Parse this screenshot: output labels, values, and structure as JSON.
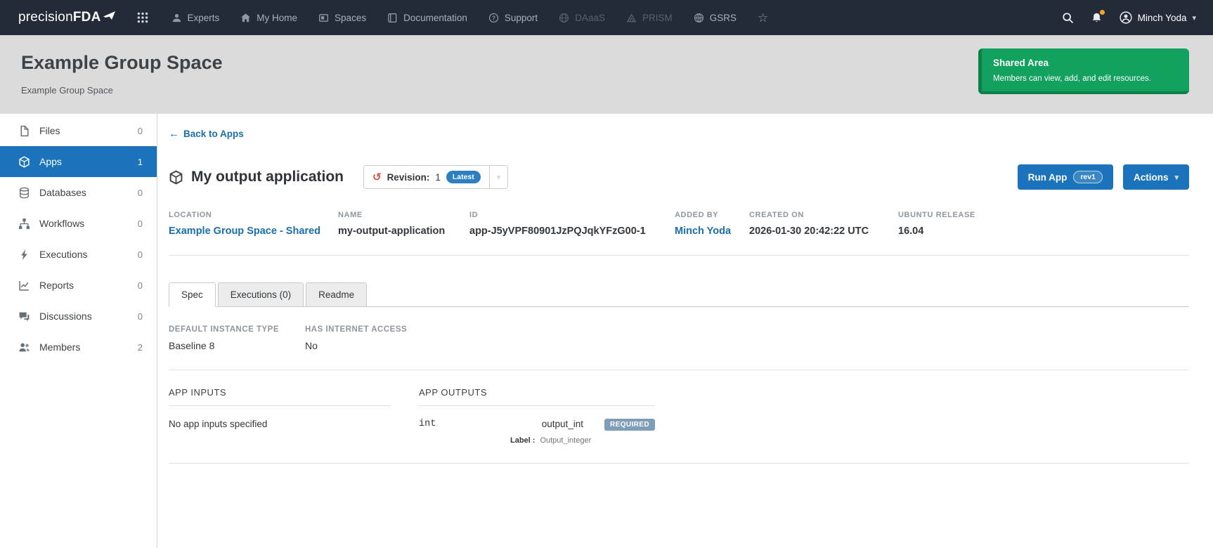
{
  "colors": {
    "navbar_bg": "#232b39",
    "accent_blue": "#1b74bb",
    "link_blue": "#1a6fad",
    "latest_badge_blue": "#2e7fc2",
    "shared_area_green": "#12a15f",
    "required_badge_blue": "#7f9db9",
    "notification_dot_orange": "#f5a623"
  },
  "navbar": {
    "brand_light": "precision",
    "brand_bold": "FDA",
    "items": [
      {
        "label": "Experts"
      },
      {
        "label": "My Home"
      },
      {
        "label": "Spaces"
      },
      {
        "label": "Documentation"
      },
      {
        "label": "Support"
      },
      {
        "label": "DAaaS"
      },
      {
        "label": "PRISM"
      },
      {
        "label": "GSRS"
      }
    ],
    "user_name": "Minch Yoda"
  },
  "header": {
    "title": "Example Group Space",
    "subtitle": "Example Group Space",
    "shared_area_title": "Shared Area",
    "shared_area_description": "Members can view, add, and edit resources."
  },
  "sidebar": {
    "items": [
      {
        "label": "Files",
        "count": "0"
      },
      {
        "label": "Apps",
        "count": "1"
      },
      {
        "label": "Databases",
        "count": "0"
      },
      {
        "label": "Workflows",
        "count": "0"
      },
      {
        "label": "Executions",
        "count": "0"
      },
      {
        "label": "Reports",
        "count": "0"
      },
      {
        "label": "Discussions",
        "count": "0"
      },
      {
        "label": "Members",
        "count": "2"
      }
    ]
  },
  "main": {
    "back_link": "Back to Apps",
    "app_title": "My output application",
    "revision_label": "Revision:",
    "revision_number": "1",
    "revision_badge": "Latest",
    "run_app_label": "Run App",
    "run_app_badge": "rev1",
    "actions_label": "Actions",
    "meta": [
      {
        "label": "LOCATION",
        "value": "Example Group Space - Shared"
      },
      {
        "label": "NAME",
        "value": "my-output-application"
      },
      {
        "label": "ID",
        "value": "app-J5yVPF80901JzPQJqkYFzG00-1"
      },
      {
        "label": "ADDED BY",
        "value": "Minch Yoda"
      },
      {
        "label": "CREATED ON",
        "value": "2026-01-30 20:42:22 UTC"
      },
      {
        "label": "UBUNTU RELEASE",
        "value": "16.04"
      }
    ],
    "tabs": [
      {
        "label": "Spec"
      },
      {
        "label": "Executions (0)"
      },
      {
        "label": "Readme"
      }
    ],
    "spec": {
      "instance_label": "DEFAULT INSTANCE TYPE",
      "instance_value": "Baseline 8",
      "internet_label": "HAS INTERNET ACCESS",
      "internet_value": "No",
      "inputs_title": "APP INPUTS",
      "inputs_empty": "No app inputs specified",
      "outputs_title": "APP OUTPUTS",
      "output": {
        "type": "int",
        "name": "output_int",
        "required_badge": "REQUIRED",
        "label_key": "Label :",
        "label_value": "Output_integer"
      }
    }
  }
}
